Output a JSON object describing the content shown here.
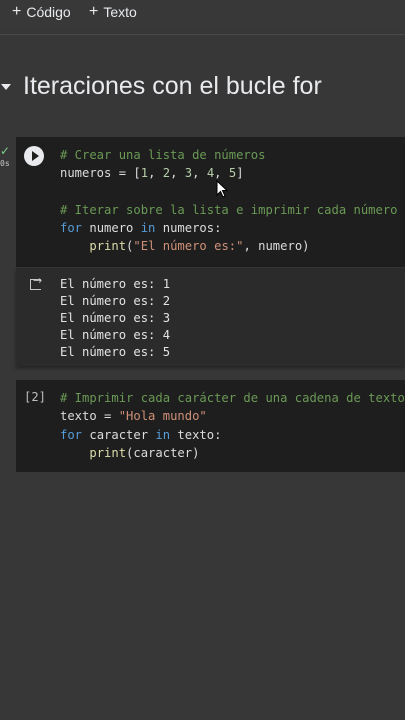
{
  "toolbar": {
    "code_label": "Código",
    "text_label": "Texto"
  },
  "section": {
    "title": "Iteraciones con el bucle for"
  },
  "cell1": {
    "status_icon": "check-icon",
    "exec_time": "0s",
    "code": [
      "# Crear una lista de números",
      "numeros = [1, 2, 3, 4, 5]",
      "",
      "# Iterar sobre la lista e imprimir cada número",
      "for numero in numeros:",
      "    print(\"El número es:\", numero)"
    ]
  },
  "output1": {
    "lines": [
      "El número es: 1",
      "El número es: 2",
      "El número es: 3",
      "El número es: 4",
      "El número es: 5"
    ]
  },
  "cell2": {
    "exec_count": "[2]",
    "code": [
      "# Imprimir cada carácter de una cadena de texto",
      "texto = \"Hola mundo\"",
      "for caracter in texto:",
      "    print(caracter)"
    ]
  },
  "colors": {
    "background": "#373737",
    "cell": "#1e1e1e",
    "comment": "#6a9955",
    "keyword": "#569cd6",
    "string": "#ce9178",
    "success": "#7fcf8a"
  }
}
